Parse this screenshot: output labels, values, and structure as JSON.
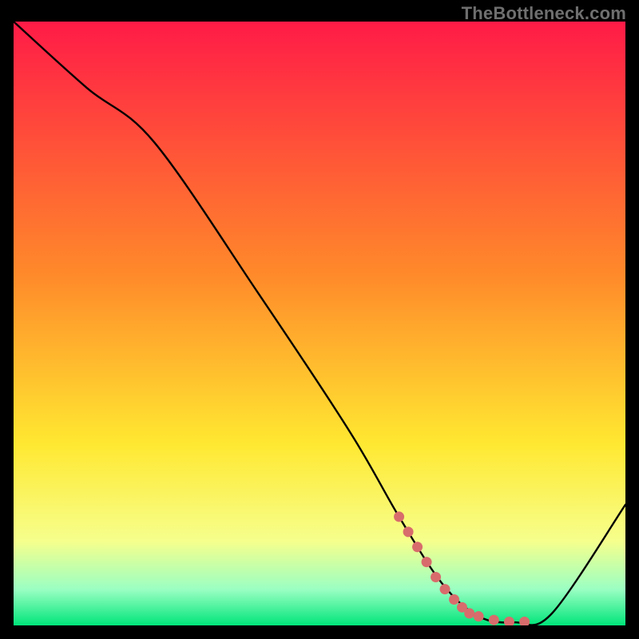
{
  "watermark": "TheBottleneck.com",
  "colors": {
    "top": "#ff1b47",
    "mid1": "#ff8a2a",
    "mid2": "#ffe831",
    "mid3": "#f6ff8c",
    "mid4": "#9bffc3",
    "bottom": "#00e57a",
    "curve": "#000000",
    "dots": "#d86c6c"
  },
  "chart_data": {
    "type": "line",
    "title": "",
    "xlabel": "",
    "ylabel": "",
    "xlim": [
      0,
      100
    ],
    "ylim": [
      0,
      100
    ],
    "series": [
      {
        "name": "bottleneck-curve",
        "x": [
          0,
          12,
          23,
          40,
          55,
          63,
          70,
          76,
          82,
          88,
          100
        ],
        "y": [
          100,
          89,
          80,
          55,
          32,
          18,
          7,
          1.5,
          0.5,
          2,
          20
        ]
      }
    ],
    "markers": {
      "name": "highlight-dots",
      "points": [
        {
          "x": 63,
          "y": 18
        },
        {
          "x": 64.5,
          "y": 15.5
        },
        {
          "x": 66,
          "y": 13
        },
        {
          "x": 67.5,
          "y": 10.5
        },
        {
          "x": 69,
          "y": 8
        },
        {
          "x": 70.5,
          "y": 6
        },
        {
          "x": 72,
          "y": 4.3
        },
        {
          "x": 73.3,
          "y": 3
        },
        {
          "x": 74.5,
          "y": 2
        },
        {
          "x": 76,
          "y": 1.5
        },
        {
          "x": 78.5,
          "y": 0.9
        },
        {
          "x": 81,
          "y": 0.6
        },
        {
          "x": 83.5,
          "y": 0.6
        }
      ]
    }
  }
}
